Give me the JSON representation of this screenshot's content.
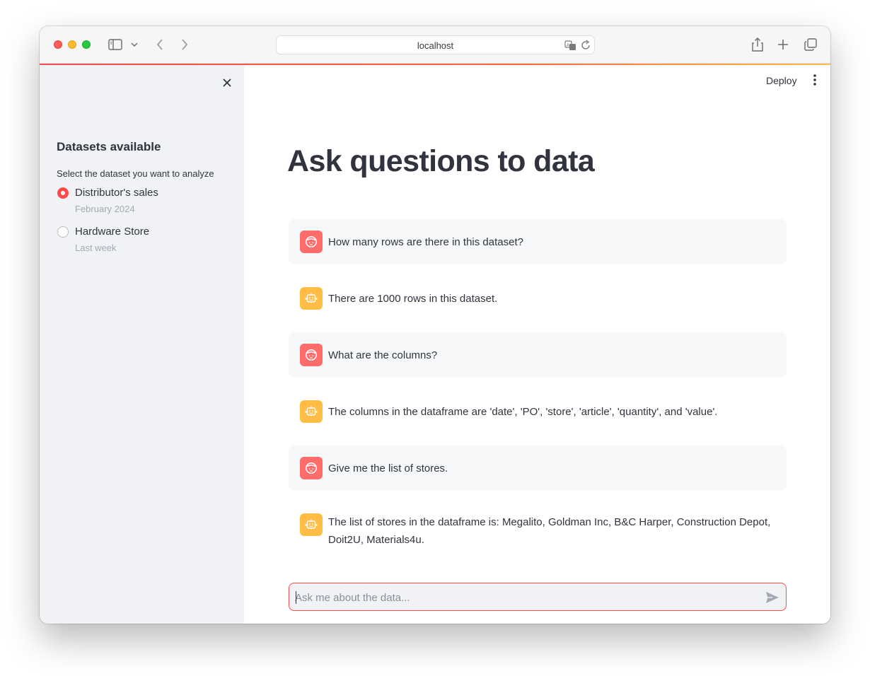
{
  "browser": {
    "url": "localhost"
  },
  "sidebar": {
    "title": "Datasets available",
    "caption": "Select the dataset you want to analyze",
    "datasets": [
      {
        "label": "Distributor's sales",
        "sub": "February 2024",
        "selected": true
      },
      {
        "label": "Hardware Store",
        "sub": "Last week",
        "selected": false
      }
    ]
  },
  "header": {
    "deploy_label": "Deploy"
  },
  "main": {
    "title": "Ask questions to data",
    "messages": [
      {
        "role": "user",
        "text": "How many rows are there in this dataset?"
      },
      {
        "role": "assistant",
        "text": "There are 1000 rows in this dataset."
      },
      {
        "role": "user",
        "text": "What are the columns?"
      },
      {
        "role": "assistant",
        "text": "The columns in the dataframe are 'date', 'PO', 'store', 'article', 'quantity', and 'value'."
      },
      {
        "role": "user",
        "text": "Give me the list of stores."
      },
      {
        "role": "assistant",
        "text": "The list of stores in the dataframe is: Megalito, Goldman Inc, B&C Harper, Construction Depot, Doit2U, Materials4u."
      }
    ],
    "input_placeholder": "Ask me about the data..."
  },
  "colors": {
    "accent": "#ff4b4b",
    "user_avatar": "#ff6c6c",
    "assistant_avatar": "#ffbd45",
    "sidebar_bg": "#f0f2f6"
  }
}
